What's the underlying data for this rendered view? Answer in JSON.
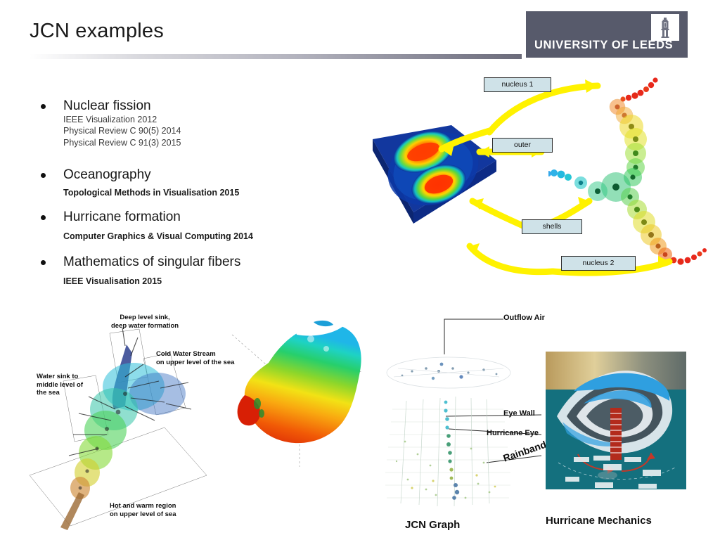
{
  "slide": {
    "title": "JCN examples"
  },
  "logo": {
    "wordmark": "UNIVERSITY OF LEEDS",
    "emblem_icon": "leeds-tower-icon",
    "bg_color": "#575a6b"
  },
  "bullets": [
    {
      "heading": "Nuclear fission",
      "sublines": [
        "IEEE Visualization 2012",
        "Physical Review C 90(5) 2014",
        "Physical Review C 91(3) 2015"
      ],
      "sub_style": "light"
    },
    {
      "heading": "Oceanography",
      "sublines": [
        "Topological Methods in Visualisation 2015"
      ],
      "sub_style": "strong"
    },
    {
      "heading": "Hurricane formation",
      "sublines": [
        "Computer Graphics & Visual Computing 2014"
      ],
      "sub_style": "strong"
    },
    {
      "heading": "Mathematics of singular fibers",
      "sublines": [
        "IEEE Visualisation 2015"
      ],
      "sub_style": "strong"
    }
  ],
  "fission_figure": {
    "callouts": [
      {
        "label": "nucleus 1"
      },
      {
        "label": "outer"
      },
      {
        "label": "shells"
      },
      {
        "label": "nucleus 2"
      }
    ],
    "arrow_color": "#fff200",
    "callout_bg": "#cfe2e8"
  },
  "ocean_mesh": {
    "annotations": [
      {
        "lines": [
          "Deep level sink,",
          "deep water formation"
        ]
      },
      {
        "lines": [
          "Cold Water Stream",
          "on upper level of the sea"
        ]
      },
      {
        "lines": [
          "Water sink to",
          "middle level of",
          "the sea"
        ]
      },
      {
        "lines": [
          "Hot and warm region",
          "on upper level of sea"
        ]
      }
    ]
  },
  "hurricane_figure": {
    "labels": [
      {
        "text": "Outflow Air"
      },
      {
        "text": "Eye Wall"
      },
      {
        "text": "Hurricane Eye"
      },
      {
        "text": "Rainband"
      }
    ],
    "captions": {
      "jcn_graph": "JCN Graph",
      "hurricane_mechanics": "Hurricane Mechanics"
    }
  }
}
